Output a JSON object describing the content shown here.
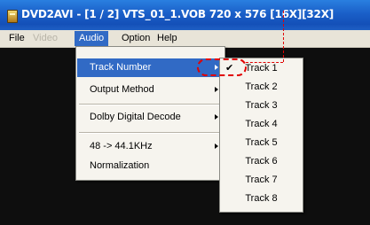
{
  "window": {
    "title": "DVD2AVI - [1 / 2] VTS_01_1.VOB 720 x 576 [16X][32X]"
  },
  "menubar": {
    "file": "File",
    "video": "Video",
    "audio": "Audio",
    "option": "Option",
    "help": "Help"
  },
  "audio_menu": {
    "track_number": "Track Number",
    "output_method": "Output Method",
    "dolby_digital_decode": "Dolby Digital Decode",
    "resample": "48 -> 44.1KHz",
    "normalization": "Normalization"
  },
  "track_submenu": {
    "items": [
      "Track 1",
      "Track 2",
      "Track 3",
      "Track 4",
      "Track 5",
      "Track 6",
      "Track 7",
      "Track 8"
    ],
    "checked": "Track 1",
    "check_glyph": "✔"
  },
  "colors": {
    "titlebar": "#1a5fc8",
    "highlight": "#316ac5",
    "annotation": "#e00000",
    "video_area": "#0e0e0e"
  }
}
